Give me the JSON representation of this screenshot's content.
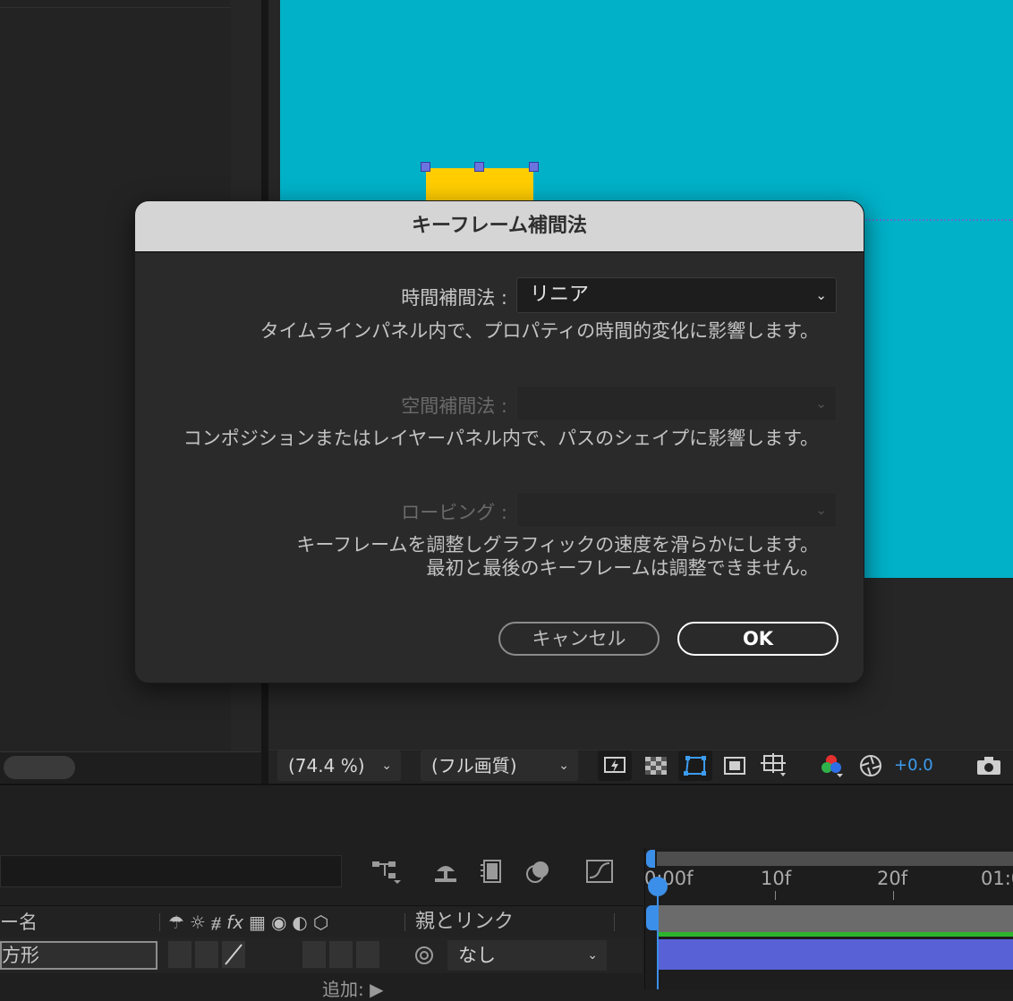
{
  "dialog": {
    "title": "キーフレーム補間法",
    "temporal": {
      "label": "時間補間法 :",
      "value": "リニア",
      "description": "タイムラインパネル内で、プロパティの時間的変化に影響します。"
    },
    "spatial": {
      "label": "空間補間法 :",
      "value": "",
      "description": "コンポジションまたはレイヤーパネル内で、パスのシェイプに影響します。"
    },
    "roving": {
      "label": "ロービング :",
      "value": "",
      "description_line1": "キーフレームを調整しグラフィックの速度を滑らかにします。",
      "description_line2": "最初と最後のキーフレームは調整できません。"
    },
    "cancel_label": "キャンセル",
    "ok_label": "OK"
  },
  "viewer_toolbar": {
    "zoom": "(74.4 %)",
    "resolution": "(フル画質)",
    "exposure": "+0.0"
  },
  "timeline": {
    "column_name": "ー名",
    "column_parent": "親とリンク",
    "layer_name": "方形",
    "parent_value": "なし",
    "add_label": "追加:",
    "ruler_labels": [
      "0:00f",
      "10f",
      "20f",
      "01:0"
    ],
    "switch_fx": "fx"
  },
  "colors": {
    "comp_background": "#00b1c8",
    "shape_fill": "#ffcd00",
    "accent_blue": "#3c8fe8",
    "layer_bar": "#5862d6"
  }
}
